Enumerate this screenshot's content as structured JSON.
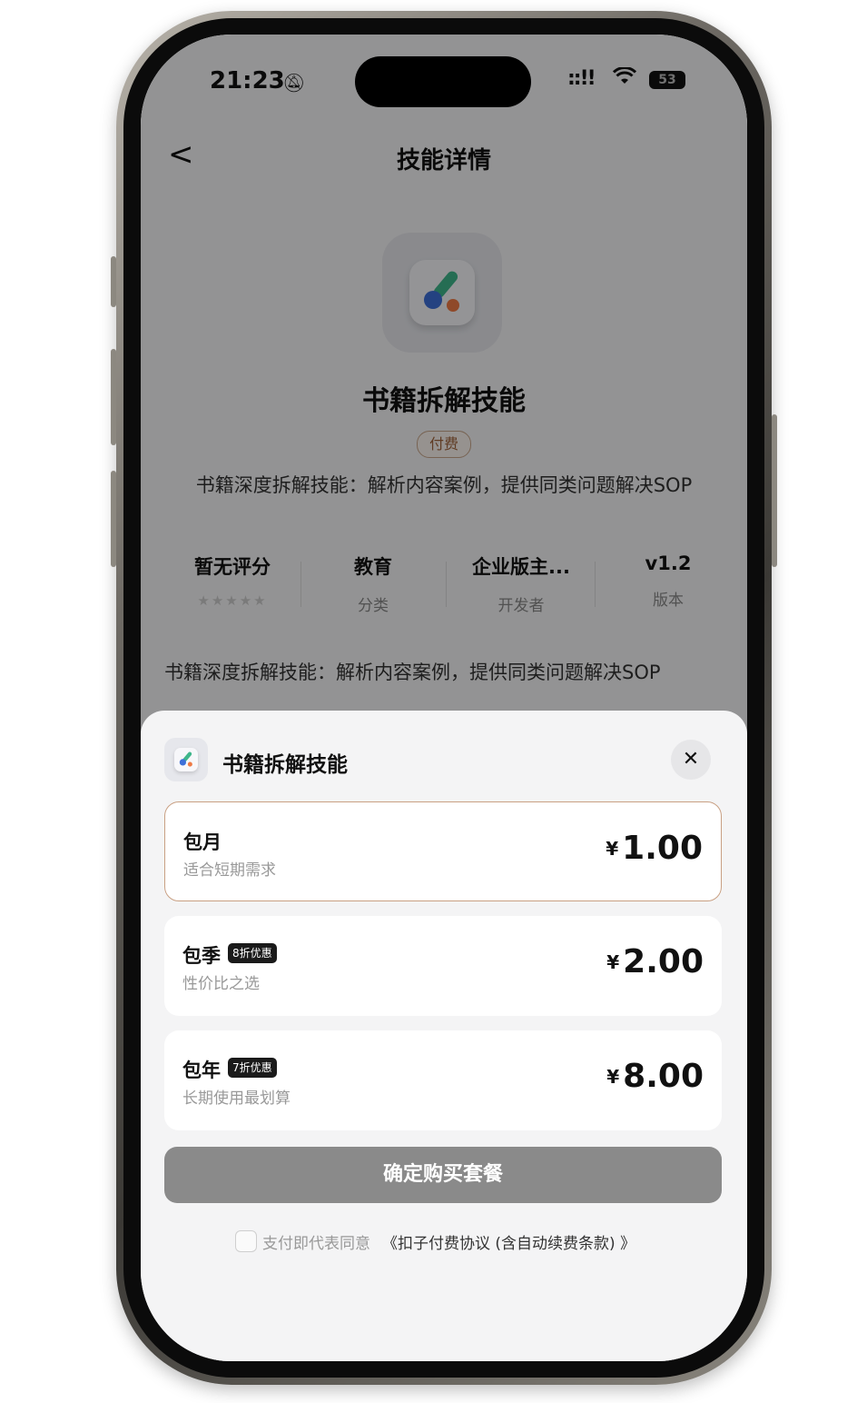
{
  "status_bar": {
    "time": "21:23",
    "battery": "53"
  },
  "nav": {
    "back_glyph": "<",
    "title": "技能详情"
  },
  "skill": {
    "name": "书籍拆解技能",
    "badge": "付费",
    "short_description": "书籍深度拆解技能：解析内容案例，提供同类问题解决SOP",
    "long_description": "书籍深度拆解技能：解析内容案例，提供同类问题解决SOP",
    "icon": "brush-palette-icon"
  },
  "stats": [
    {
      "value": "暂无评分",
      "label": "",
      "rating_stars": 0
    },
    {
      "value": "教育",
      "label": "分类"
    },
    {
      "value": "企业版主...",
      "label": "开发者"
    },
    {
      "value": "v1.2",
      "label": "版本"
    }
  ],
  "sheet": {
    "title": "书籍拆解技能",
    "close_glyph": "✕",
    "plans": [
      {
        "name": "包月",
        "desc": "适合短期需求",
        "discount": "",
        "currency": "¥",
        "price": "1.00",
        "selected": true
      },
      {
        "name": "包季",
        "desc": "性价比之选",
        "discount": "8折优惠",
        "currency": "¥",
        "price": "2.00",
        "selected": false
      },
      {
        "name": "包年",
        "desc": "长期使用最划算",
        "discount": "7折优惠",
        "currency": "¥",
        "price": "8.00",
        "selected": false
      }
    ],
    "buy_button": "确定购买套餐",
    "agreement_prefix": "支付即代表同意",
    "agreement_link": "《扣子付费协议 (含自动续费条款) 》",
    "agreement_checked": false
  },
  "colors": {
    "accent_border": "#c9a083",
    "button_disabled": "#8a8a8a",
    "badge_text": "#a0643c"
  }
}
